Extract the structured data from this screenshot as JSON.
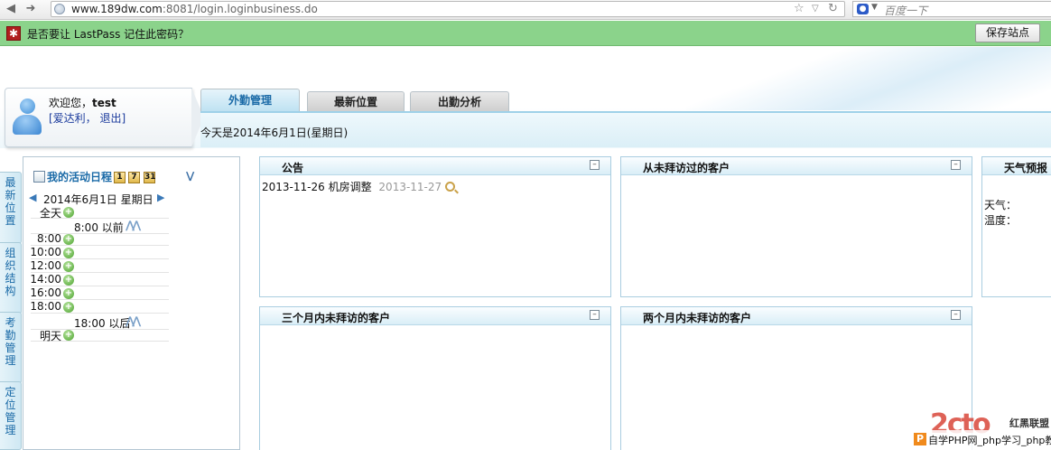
{
  "browser": {
    "url_host": "www.189dw.com",
    "url_rest": ":8081/login.loginbusiness.do",
    "search_placeholder": "百度一下",
    "back_icon": "back-arrow-icon",
    "forward_icon": "forward-arrow-icon"
  },
  "lastpass": {
    "prompt": "是否要让 LastPass 记住此密码？",
    "save_button": "保存站点"
  },
  "user": {
    "welcome_prefix": "欢迎您，",
    "username": "test",
    "links": "[爱达利， 退出]"
  },
  "tabs": [
    {
      "label": "外勤管理",
      "active": true
    },
    {
      "label": "最新位置",
      "active": false
    },
    {
      "label": "出勤分析",
      "active": false
    }
  ],
  "today_text": "今天是2014年6月1日(星期日)",
  "side_tabs": [
    {
      "label": "最新位置"
    },
    {
      "label": "组织结构"
    },
    {
      "label": "考勤管理"
    },
    {
      "label": "定位管理"
    }
  ],
  "calendar": {
    "title": "我的活动日程",
    "view_buttons": [
      "1",
      "7",
      "31"
    ],
    "date_label": "2014年6月1日  星期日",
    "slots": [
      {
        "label": "全天",
        "type": "plus"
      },
      {
        "label": "8:00 以前",
        "type": "wide"
      },
      {
        "label": "8:00",
        "type": "plus"
      },
      {
        "label": "10:00",
        "type": "plus"
      },
      {
        "label": "12:00",
        "type": "plus"
      },
      {
        "label": "14:00",
        "type": "plus"
      },
      {
        "label": "16:00",
        "type": "plus"
      },
      {
        "label": "18:00",
        "type": "plus"
      },
      {
        "label": "18:00 以后",
        "type": "wide"
      },
      {
        "label": "明天",
        "type": "plus"
      }
    ]
  },
  "portlets": {
    "notice": {
      "title": "公告",
      "item_date": "2013-11-26",
      "item_title": "机房调整",
      "item_posted": "2013-11-27"
    },
    "never_visited": {
      "title": "从未拜访过的客户"
    },
    "weather": {
      "title": "天气预报",
      "weather_label": "天气：",
      "temp_label": "温度："
    },
    "three_months": {
      "title": "三个月内未拜访的客户"
    },
    "two_months": {
      "title": "两个月内未拜访的客户"
    }
  },
  "watermark": {
    "logo": "2cto",
    "side": "红黑联盟",
    "text": "自学PHP网_php学习_php教"
  }
}
